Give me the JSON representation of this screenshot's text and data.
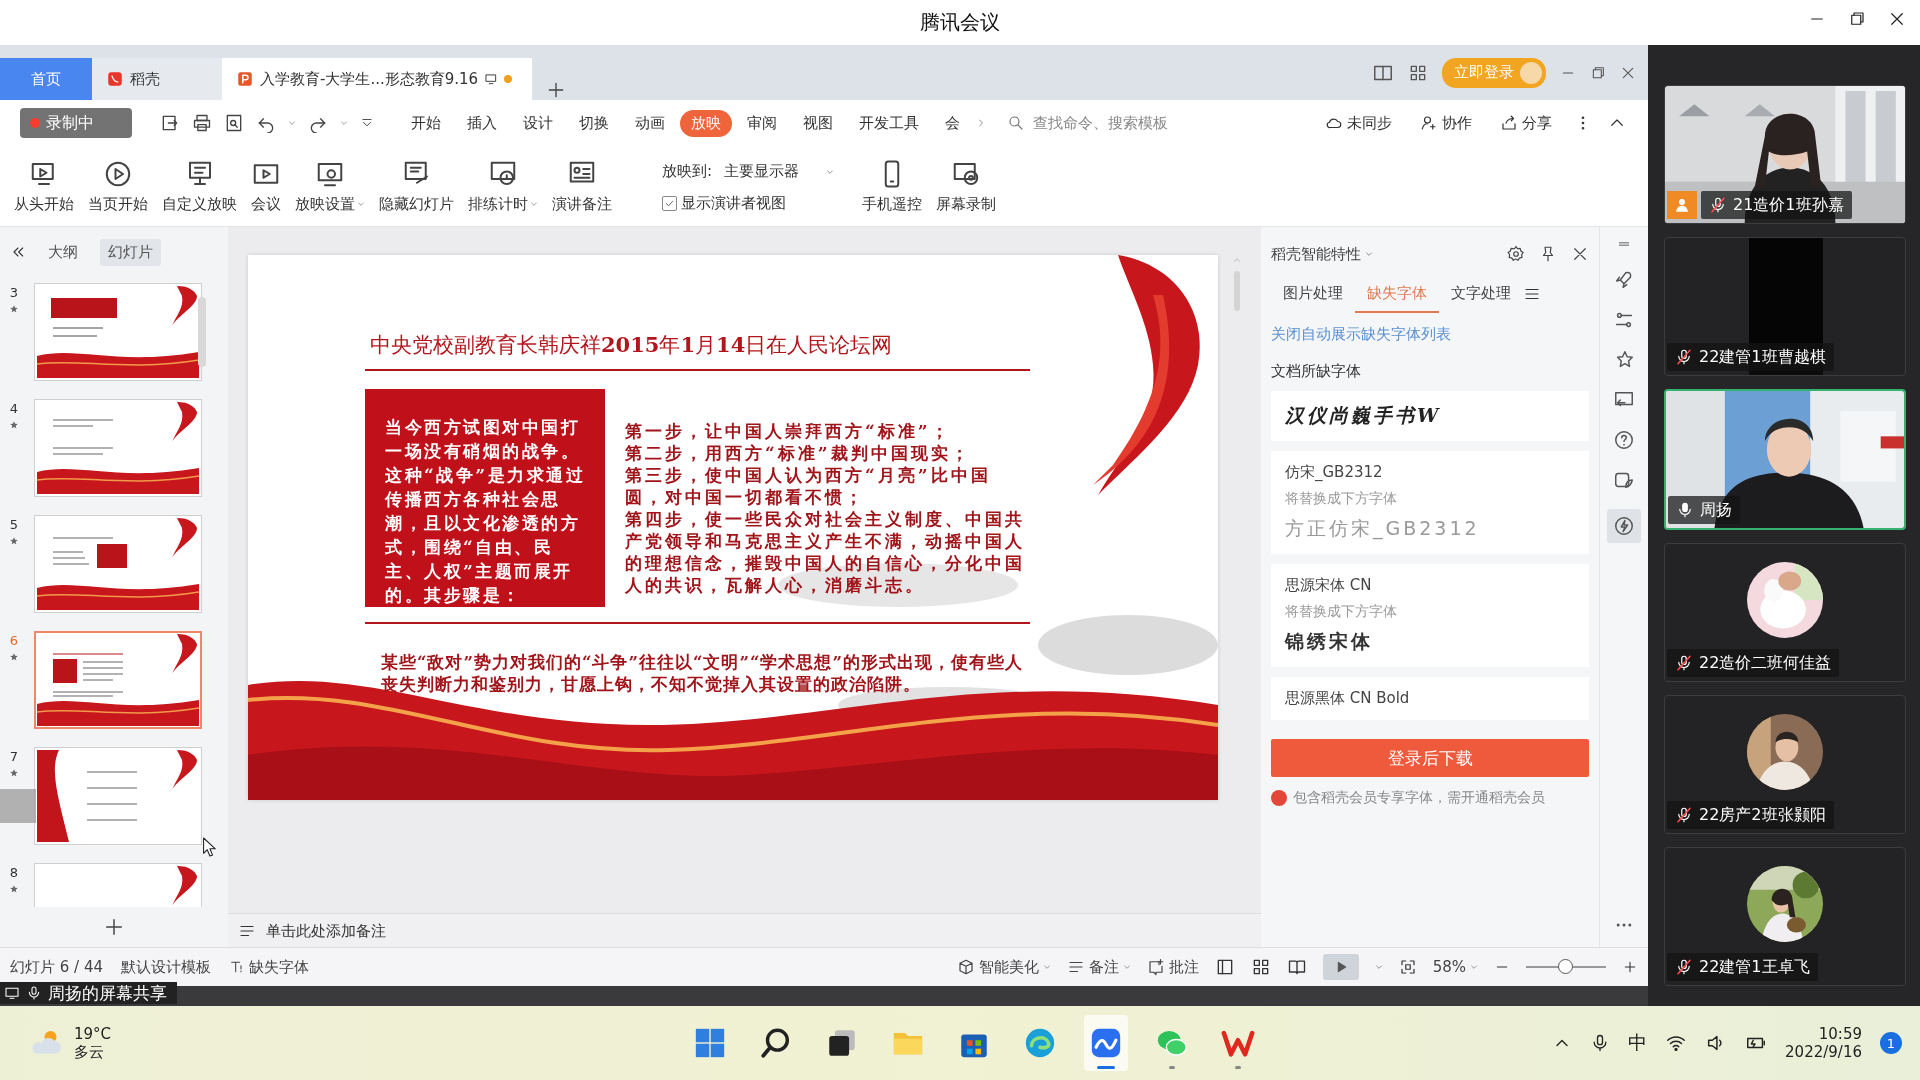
{
  "meeting": {
    "title": "腾讯会议"
  },
  "doc_tabs": [
    {
      "kind": "home",
      "label": "首页",
      "selected": false
    },
    {
      "kind": "docer",
      "label": "稻壳",
      "selected": false
    },
    {
      "kind": "document",
      "label": "入学教育-大学生...形态教育9.16",
      "selected": true
    }
  ],
  "login_button": "立即登录",
  "recording_badge": "录制中",
  "menu": [
    {
      "label": "开始",
      "selected": false
    },
    {
      "label": "插入",
      "selected": false
    },
    {
      "label": "设计",
      "selected": false
    },
    {
      "label": "切换",
      "selected": false
    },
    {
      "label": "动画",
      "selected": false
    },
    {
      "label": "放映",
      "selected": true
    },
    {
      "label": "审阅",
      "selected": false
    },
    {
      "label": "视图",
      "selected": false
    },
    {
      "label": "开发工具",
      "selected": false
    },
    {
      "label": "会",
      "selected": false
    }
  ],
  "search": {
    "placeholder": "查找命令、搜索模板"
  },
  "actions": [
    "未同步",
    "协作",
    "分享"
  ],
  "ribbon": {
    "items": [
      {
        "label": "从头开始",
        "dropdown": false
      },
      {
        "label": "当页开始",
        "dropdown": false
      },
      {
        "label": "自定义放映",
        "dropdown": false
      },
      {
        "label": "会议",
        "dropdown": false
      },
      {
        "label": "放映设置",
        "dropdown": true
      },
      {
        "label": "隐藏幻灯片",
        "dropdown": false
      },
      {
        "label": "排练计时",
        "dropdown": true
      },
      {
        "label": "演讲备注",
        "dropdown": false
      }
    ],
    "output": {
      "label": "放映到:",
      "value": "主要显示器"
    },
    "presenter_view": {
      "label": "显示演讲者视图",
      "checked": true
    },
    "tools": [
      {
        "label": "手机遥控"
      },
      {
        "label": "屏幕录制"
      }
    ]
  },
  "outline_tabs": [
    {
      "label": "大纲",
      "selected": false
    },
    {
      "label": "幻灯片",
      "selected": true
    }
  ],
  "slides": [
    {
      "number": "3",
      "selected": false
    },
    {
      "number": "4",
      "selected": false
    },
    {
      "number": "5",
      "selected": false
    },
    {
      "number": "6",
      "selected": true
    },
    {
      "number": "7",
      "selected": false
    },
    {
      "number": "8",
      "selected": false
    }
  ],
  "slide": {
    "title": "中央党校副教育长韩庆祥**2015**年**1**月**14**日在人民论坛网",
    "summary": "当今西方试图对中国打一场没有硝烟的战争。这种“战争”是力求通过传播西方各种社会思潮，且以文化渗透的方式，围绕“自由、民主、人权”主题而展开的。其步骤是：",
    "steps": [
      "第一步，让中国人崇拜西方“标准”；",
      "第二步，用西方“标准”裁判中国现实；",
      "第三步，使中国人认为西方“月亮”比中国圆，对中国一切都看不惯；",
      "第四步，使一些民众对社会主义制度、中国共产党领导和马克思主义产生不满，动摇中国人的理想信念，摧毁中国人的自信心，分化中国人的共识，瓦解人心，消磨斗志。"
    ],
    "footer": "某些“敌对”势力对我们的“斗争”往往以“文明”“学术思想”的形式出现，使有些人丧失判断力和鉴别力，甘愿上钩，不知不觉掉入其设置的政治陷阱。"
  },
  "notes": {
    "placeholder": "单击此处添加备注"
  },
  "font_panel": {
    "title": "稻壳智能特性",
    "tabs": [
      {
        "label": "图片处理",
        "selected": false
      },
      {
        "label": "缺失字体",
        "selected": true
      },
      {
        "label": "文字处理",
        "selected": false
      }
    ],
    "link": "关闭自动展示缺失字体列表",
    "section": "文档所缺字体",
    "fonts": [
      {
        "kind": "sample",
        "name": "汉仪尚巍手书W"
      },
      {
        "kind": "replace",
        "name": "仿宋_GB2312",
        "hint": "将替换成下方字体",
        "replacement": "方正仿宋_GB2312"
      },
      {
        "kind": "replace",
        "name": "思源宋体 CN",
        "hint": "将替换成下方字体",
        "replacement": "锦绣宋体"
      },
      {
        "kind": "plain",
        "name": "思源黑体 CN Bold"
      }
    ],
    "button": "登录后下载",
    "note": "包含稻壳会员专享字体，需开通稻壳会员"
  },
  "status_bar": {
    "slide_count": "幻灯片 6 / 44",
    "template": "默认设计模板",
    "missing_fonts": "缺失字体",
    "beautify": "智能美化",
    "notes": "备注",
    "comments": "批注",
    "zoom": "58%",
    "zoom_slider": {
      "level": 0.5
    }
  },
  "share_label": "周扬的屏幕共享",
  "participants": [
    {
      "name": "21造价1班孙嘉",
      "kind": "video",
      "muted": true,
      "host": true,
      "selected": false
    },
    {
      "name": "22建管1班曹越棋",
      "kind": "video",
      "muted": true,
      "host": false,
      "selected": false
    },
    {
      "name": "周扬",
      "kind": "video",
      "muted": false,
      "host": false,
      "selected": true
    },
    {
      "name": "22造价二班何佳益",
      "kind": "avatar",
      "muted": true,
      "host": false,
      "selected": false
    },
    {
      "name": "22房产2班张颢阳",
      "kind": "avatar",
      "muted": true,
      "host": false,
      "selected": false
    },
    {
      "name": "22建管1王卓飞",
      "kind": "avatar",
      "muted": true,
      "host": false,
      "selected": false
    }
  ],
  "taskbar": {
    "weather": {
      "temperature": "19°C",
      "condition": "多云"
    },
    "apps": [
      {
        "kind": "start",
        "active": false,
        "running": false
      },
      {
        "kind": "search",
        "active": false,
        "running": false
      },
      {
        "kind": "taskview",
        "active": false,
        "running": false
      },
      {
        "kind": "folder",
        "active": false,
        "running": false
      },
      {
        "kind": "store",
        "active": false,
        "running": false
      },
      {
        "kind": "browser",
        "active": false,
        "running": false
      },
      {
        "kind": "meeting",
        "active": true,
        "running": true
      },
      {
        "kind": "chat",
        "active": false,
        "running": true
      },
      {
        "kind": "office",
        "active": false,
        "running": true
      }
    ],
    "ime": "中",
    "time": "10:59",
    "date": "2022/9/16",
    "notifications": "1"
  }
}
